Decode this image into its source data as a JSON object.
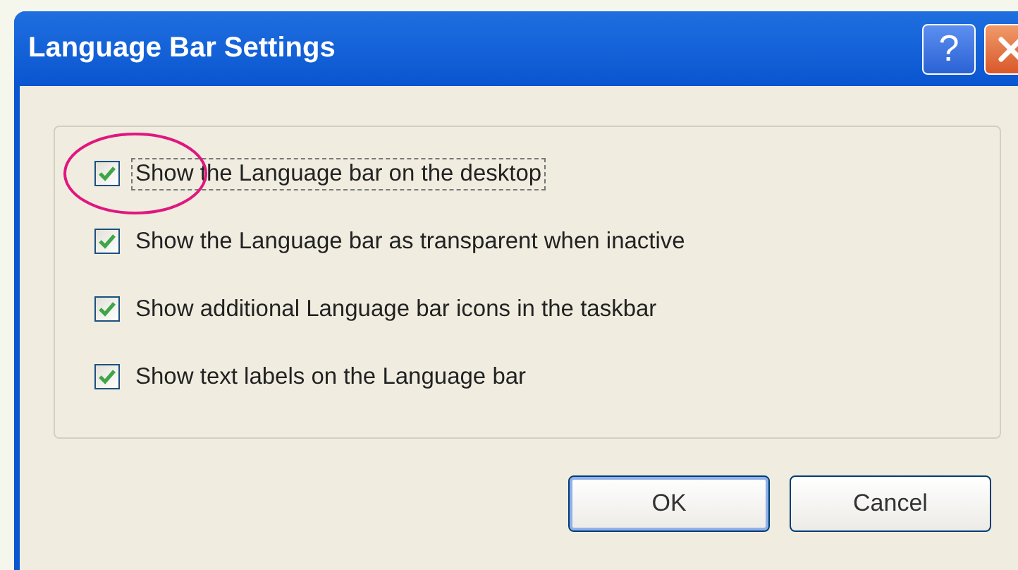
{
  "window": {
    "title": "Language Bar Settings"
  },
  "title_buttons": [
    {
      "kind": "help",
      "label": "?"
    },
    {
      "kind": "close"
    }
  ],
  "options": [
    {
      "label": "Show the Language bar on the desktop",
      "checked": true,
      "focused": true,
      "circled": true
    },
    {
      "label": "Show the Language bar as transparent when inactive",
      "checked": true,
      "focused": false,
      "circled": false
    },
    {
      "label": "Show additional Language bar icons in the taskbar",
      "checked": true,
      "focused": false,
      "circled": false
    },
    {
      "label": "Show text labels on the Language bar",
      "checked": true,
      "focused": false,
      "circled": false
    }
  ],
  "buttons": [
    "OK",
    "Cancel"
  ]
}
